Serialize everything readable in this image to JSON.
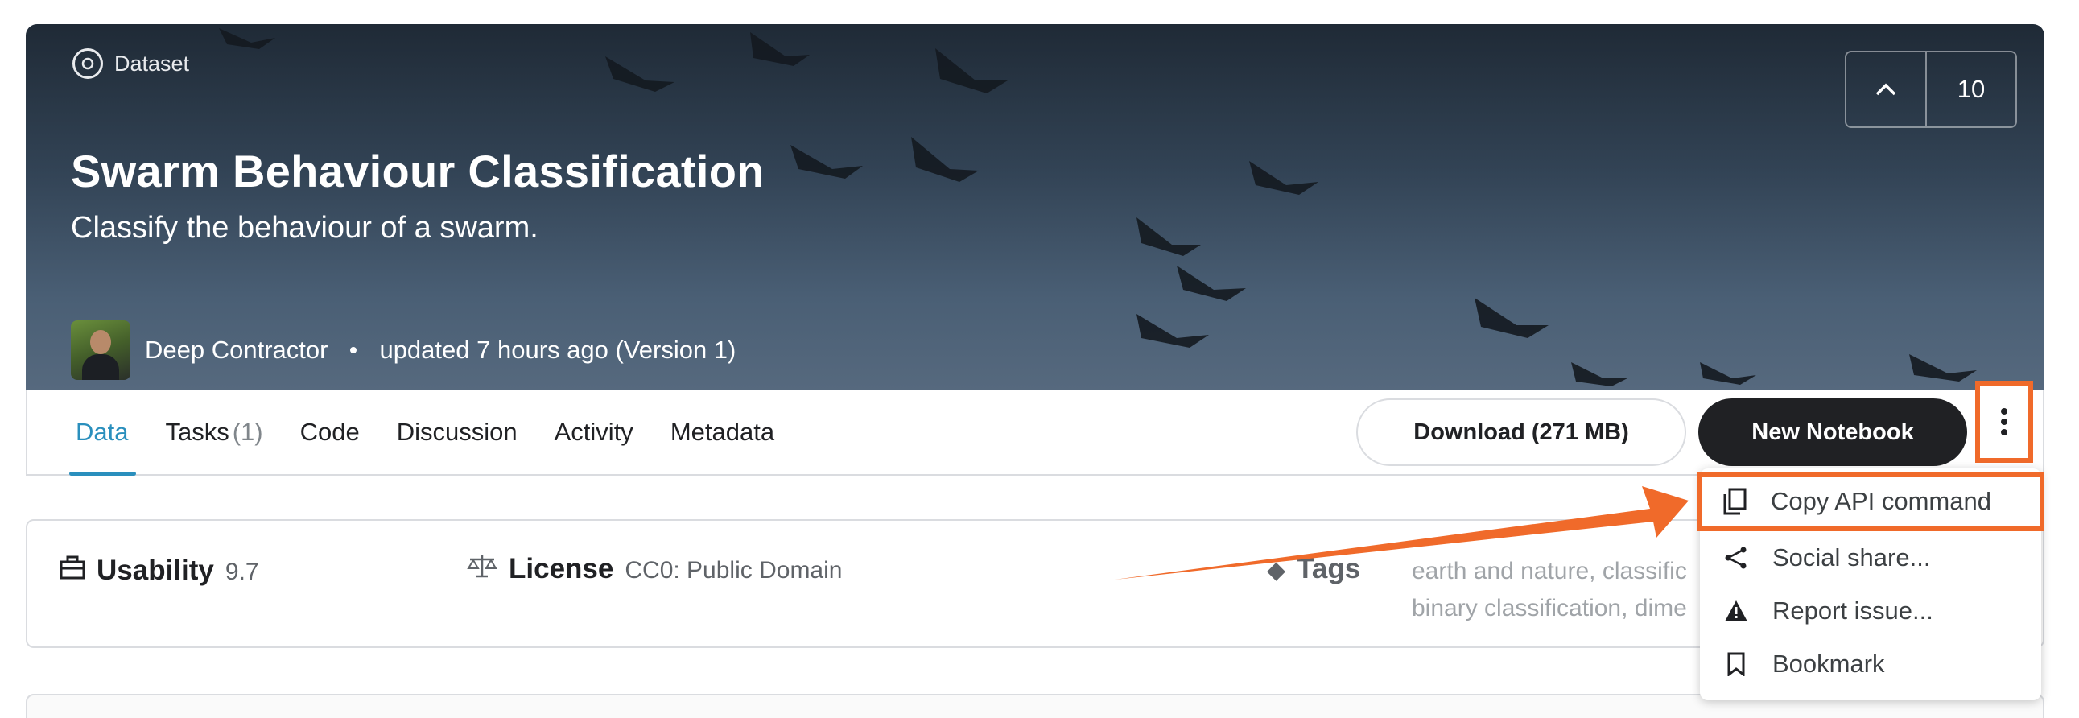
{
  "hero": {
    "badge": "Dataset",
    "title": "Swarm Behaviour Classification",
    "subtitle": "Classify the behaviour of a swarm.",
    "author": "Deep Contractor",
    "updated": "updated 7 hours ago (Version 1)",
    "vote_count": "10"
  },
  "tabs": [
    {
      "label": "Data",
      "count": ""
    },
    {
      "label": "Tasks",
      "count": "(1)"
    },
    {
      "label": "Code",
      "count": ""
    },
    {
      "label": "Discussion",
      "count": ""
    },
    {
      "label": "Activity",
      "count": ""
    },
    {
      "label": "Metadata",
      "count": ""
    }
  ],
  "actions": {
    "download": "Download (271 MB)",
    "new_notebook": "New Notebook"
  },
  "info": {
    "usability_label": "Usability",
    "usability_value": "9.7",
    "license_label": "License",
    "license_value": "CC0: Public Domain",
    "tags_label": "Tags",
    "tags_line1": "earth and nature, classific",
    "tags_line2": "binary classification, dime"
  },
  "menu": {
    "items": [
      {
        "label": "Copy API command",
        "icon": "copy-icon"
      },
      {
        "label": "Social share...",
        "icon": "share-icon"
      },
      {
        "label": "Report issue...",
        "icon": "warning-icon"
      },
      {
        "label": "Bookmark",
        "icon": "bookmark-icon"
      }
    ]
  },
  "colors": {
    "accent": "#2a8fbd",
    "highlight": "#f06a2a",
    "button_dark": "#202124"
  }
}
